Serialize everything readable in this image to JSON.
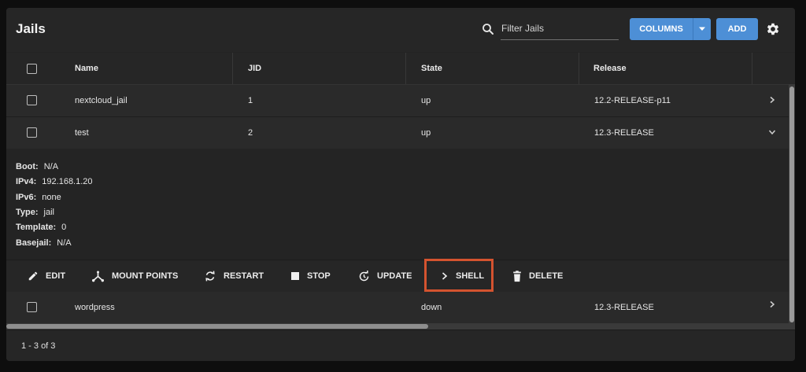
{
  "header": {
    "title": "Jails",
    "filter_placeholder": "Filter Jails",
    "columns_label": "COLUMNS",
    "add_label": "ADD"
  },
  "table": {
    "columns": [
      "Name",
      "JID",
      "State",
      "Release"
    ],
    "rows": [
      {
        "name": "nextcloud_jail",
        "jid": "1",
        "state": "up",
        "release": "12.2-RELEASE-p11",
        "expanded": false
      },
      {
        "name": "test",
        "jid": "2",
        "state": "up",
        "release": "12.3-RELEASE",
        "expanded": true
      },
      {
        "name": "wordpress",
        "jid": "",
        "state": "down",
        "release": "12.3-RELEASE",
        "expanded": false
      }
    ]
  },
  "detail": {
    "boot_label": "Boot:",
    "boot": "N/A",
    "ipv4_label": "IPv4:",
    "ipv4": "192.168.1.20",
    "ipv6_label": "IPv6:",
    "ipv6": "none",
    "type_label": "Type:",
    "type": "jail",
    "template_label": "Template:",
    "template": "0",
    "basejail_label": "Basejail:",
    "basejail": "N/A"
  },
  "actions": {
    "edit": "EDIT",
    "mount_points": "MOUNT POINTS",
    "restart": "RESTART",
    "stop": "STOP",
    "update": "UPDATE",
    "shell": "SHELL",
    "delete": "DELETE"
  },
  "footer": {
    "pagination": "1 - 3 of 3"
  },
  "colors": {
    "accent": "#4d8fd6",
    "highlight": "#d4532f"
  }
}
